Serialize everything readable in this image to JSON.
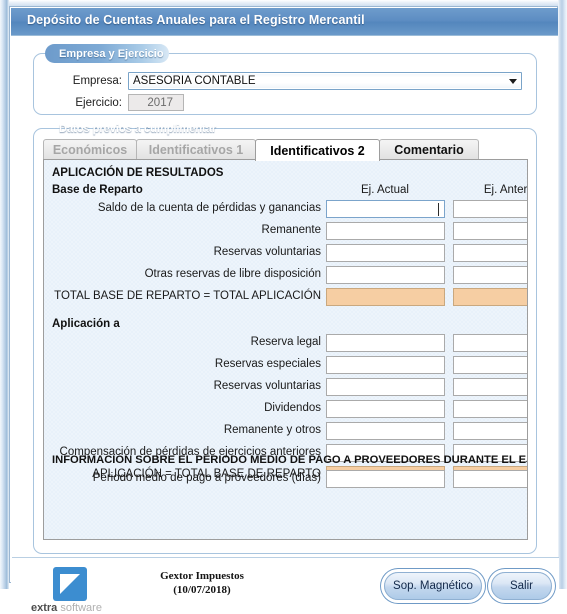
{
  "window": {
    "title": "Depósito de Cuentas Anuales para el Registro Mercantil"
  },
  "group_empresa": {
    "legend": "Empresa y Ejercicio",
    "empresa_label": "Empresa:",
    "empresa_value": "ASESORIA CONTABLE",
    "ejercicio_label": "Ejercicio:",
    "ejercicio_value": "2017"
  },
  "group_datos": {
    "legend": "Datos previos a cumplimentar",
    "tabs": [
      {
        "label": "Económicos",
        "state": "disabled"
      },
      {
        "label": "Identificativos 1",
        "state": "disabled"
      },
      {
        "label": "Identificativos 2",
        "state": "active"
      },
      {
        "label": "Comentario",
        "state": "enabled"
      }
    ]
  },
  "panel": {
    "section_aplicacion": "APLICACIÓN DE RESULTADOS",
    "section_base": "Base de Reparto",
    "section_aplicacion_a": "Aplicación a",
    "section_info": "INFORMACIÓN SOBRE EL PERIODO MEDIO DE PAGO A PROVEEDORES DURANTE EL EJERCICIO",
    "col_actual": "Ej. Actual",
    "col_anterior": "Ej. Anterior",
    "base_rows": [
      {
        "label": "Saldo de la cuenta de pérdidas y ganancias",
        "actual": "",
        "anterior": "",
        "kind": "focus"
      },
      {
        "label": "Remanente",
        "actual": "",
        "anterior": "",
        "kind": "normal"
      },
      {
        "label": "Reservas voluntarias",
        "actual": "",
        "anterior": "",
        "kind": "normal"
      },
      {
        "label": "Otras reservas de libre disposición",
        "actual": "",
        "anterior": "",
        "kind": "normal"
      },
      {
        "label": "TOTAL BASE DE REPARTO = TOTAL APLICACIÓN",
        "actual": "",
        "anterior": "",
        "kind": "total"
      }
    ],
    "aplicacion_rows": [
      {
        "label": "Reserva legal",
        "actual": "",
        "anterior": "",
        "kind": "normal"
      },
      {
        "label": "Reservas especiales",
        "actual": "",
        "anterior": "",
        "kind": "normal"
      },
      {
        "label": "Reservas voluntarias",
        "actual": "",
        "anterior": "",
        "kind": "normal"
      },
      {
        "label": "Dividendos",
        "actual": "",
        "anterior": "",
        "kind": "normal"
      },
      {
        "label": "Remanente y otros",
        "actual": "",
        "anterior": "",
        "kind": "normal"
      },
      {
        "label": "Compensación de pérdidas de ejercicios anteriores",
        "actual": "",
        "anterior": "",
        "kind": "normal"
      },
      {
        "label": "APLICACIÓN = TOTAL BASE DE REPARTO",
        "actual": "",
        "anterior": "",
        "kind": "total"
      }
    ],
    "info_rows": [
      {
        "label": "Periodo medio de pago a proveedores (días)",
        "actual": "",
        "anterior": "",
        "kind": "normal"
      }
    ]
  },
  "footer": {
    "logo_word_bold": "extra",
    "logo_word_light": "software",
    "app_name_line1": "Gextor Impuestos",
    "app_name_line2": "(10/07/2018)",
    "buttons": [
      {
        "label": "Sop. Magnético",
        "name": "sop-magnetico-button"
      },
      {
        "label": "Salir",
        "name": "salir-button"
      }
    ]
  },
  "colors": {
    "title_bar": "#5c8cc2",
    "legend_start": "#6d9bcb",
    "panel_bg": "#edf4fb",
    "total_cell": "#f6cea3",
    "accent_border": "#a8c4de"
  }
}
